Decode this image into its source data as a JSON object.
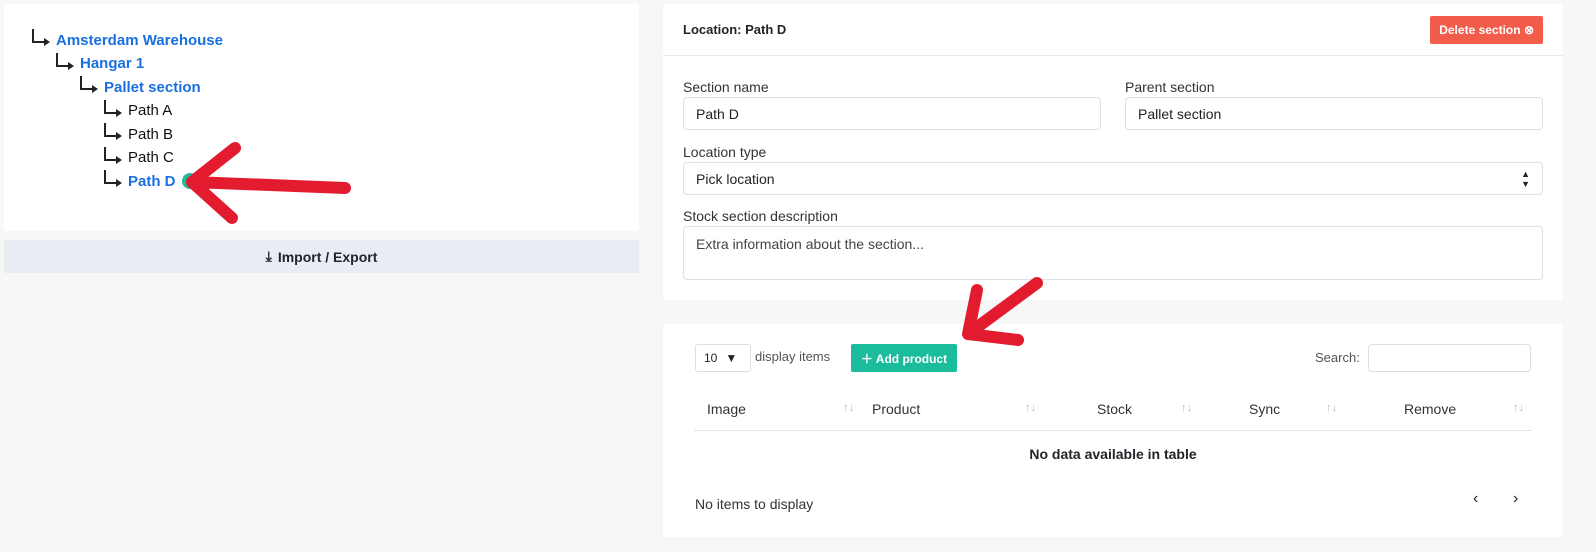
{
  "tree": {
    "nodes": [
      {
        "label": "Amsterdam Warehouse",
        "level": 0,
        "link": true
      },
      {
        "label": "Hangar 1",
        "level": 1,
        "link": true
      },
      {
        "label": "Pallet section",
        "level": 2,
        "link": true
      },
      {
        "label": "Path A",
        "level": 3,
        "link": false
      },
      {
        "label": "Path B",
        "level": 3,
        "link": false
      },
      {
        "label": "Path C",
        "level": 3,
        "link": false
      },
      {
        "label": "Path D",
        "level": 3,
        "link": true
      }
    ],
    "add_icon": "plus-circle-icon",
    "import_export": "Import / Export"
  },
  "form": {
    "title": "Location: Path D",
    "delete_label": "Delete section",
    "section_name_label": "Section name",
    "section_name": "Path D",
    "parent_label": "Parent section",
    "parent": "Pallet section",
    "location_type_label": "Location type",
    "location_type": "Pick location",
    "description_label": "Stock section description",
    "description_placeholder": "Extra information about the section..."
  },
  "table": {
    "page_size": "10",
    "display_items": "display items",
    "add_product": "Add product",
    "search_label": "Search:",
    "columns": [
      "Image",
      "Product",
      "Stock",
      "Sync",
      "Remove"
    ],
    "empty": "No data available in table",
    "info": "No items to display",
    "prev": "‹",
    "next": "›"
  },
  "colors": {
    "link": "#1a6fe0",
    "accent": "#1abc9c",
    "danger": "#f25c4a",
    "annotation": "#e31b2e"
  }
}
